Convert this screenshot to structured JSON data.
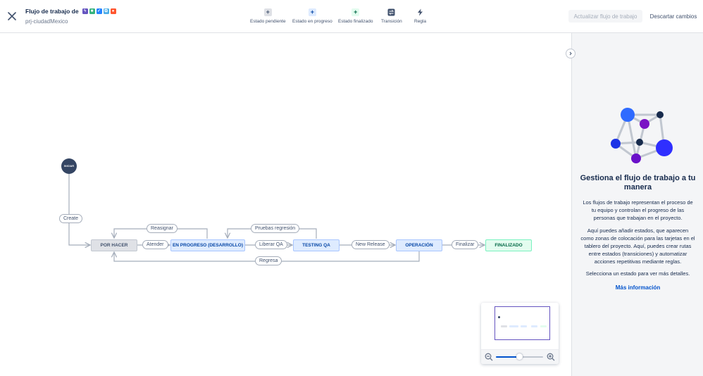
{
  "header": {
    "title": "Flujo de trabajo de",
    "project": "prj-ciudadMexico",
    "type_badges": [
      {
        "icon": "epic-icon",
        "color": "#6554c0",
        "glyph": "ϟ"
      },
      {
        "icon": "story-icon",
        "color": "#36b37e",
        "glyph": "■"
      },
      {
        "icon": "task-icon",
        "color": "#2684ff",
        "glyph": "✓"
      },
      {
        "icon": "subtask-icon",
        "color": "#4bade8",
        "glyph": "⧉"
      },
      {
        "icon": "bug-icon",
        "color": "#ff5630",
        "glyph": "●"
      }
    ],
    "toolbar": {
      "pending": "Estado pendiente",
      "in_progress": "Estado en progreso",
      "done": "Estado finalizado",
      "transition": "Transición",
      "rule": "Regla"
    },
    "update_button": "Actualizar flujo de trabajo",
    "discard_button": "Descartar cambios"
  },
  "diagram": {
    "start": "INICIAR",
    "statuses": {
      "todo": "POR HACER",
      "in_progress": "EN PROGRESO (DESARROLLO)",
      "testing": "TESTING QA",
      "operation": "OPERACIÓN",
      "done": "FINALIZADO"
    },
    "transitions": {
      "create": "Create",
      "reassign": "Reasignar",
      "attend": "Atender",
      "regression": "Pruebas regresión",
      "release_qa": "Liberar QA",
      "new_release": "New Release",
      "finish": "Finalizar",
      "back": "Regresa"
    }
  },
  "minimap": {
    "zoom_level": 0.5,
    "colors": {
      "frame": "#6554c0"
    }
  },
  "panel": {
    "title": "Gestiona el flujo de trabajo a tu manera",
    "p1": "Los flujos de trabajo representan el proceso de tu equipo y controlan el progreso de las personas que trabajan en el proyecto.",
    "p2": "Aquí puedes añadir estados, que aparecen como zonas de colocación para las tarjetas en el tablero del proyecto. Aquí, puedes crear rutas entre estados (transiciones) y automatizar acciones repetitivas mediante reglas.",
    "p3": "Selecciona un estado para ver más detalles.",
    "link": "Más información"
  }
}
